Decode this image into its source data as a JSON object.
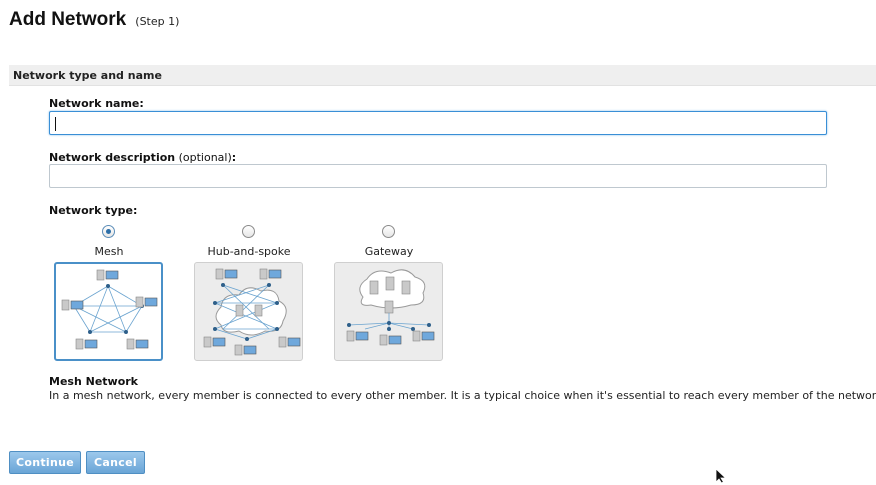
{
  "page": {
    "title": "Add Network",
    "step": "(Step 1)"
  },
  "section": {
    "title": "Network type and name"
  },
  "form": {
    "name_label": "Network name:",
    "name_value": "",
    "description_label": "Network description",
    "description_optional": "(optional)",
    "description_colon": ":",
    "description_value": "",
    "type_label": "Network type:"
  },
  "network_types": [
    {
      "label": "Mesh",
      "selected": true,
      "icon": "mesh-network-icon"
    },
    {
      "label": "Hub-and-spoke",
      "selected": false,
      "icon": "hub-and-spoke-network-icon"
    },
    {
      "label": "Gateway",
      "selected": false,
      "icon": "gateway-network-icon"
    }
  ],
  "description": {
    "title": "Mesh Network",
    "text": "In a mesh network, every member is connected to every other member. It is a typical choice when it's essential to reach every member of the network."
  },
  "buttons": {
    "continue": "Continue",
    "cancel": "Cancel"
  },
  "colors": {
    "accent": "#4a90c8",
    "button": "#7ab3e0",
    "section_bar": "#efefef"
  }
}
